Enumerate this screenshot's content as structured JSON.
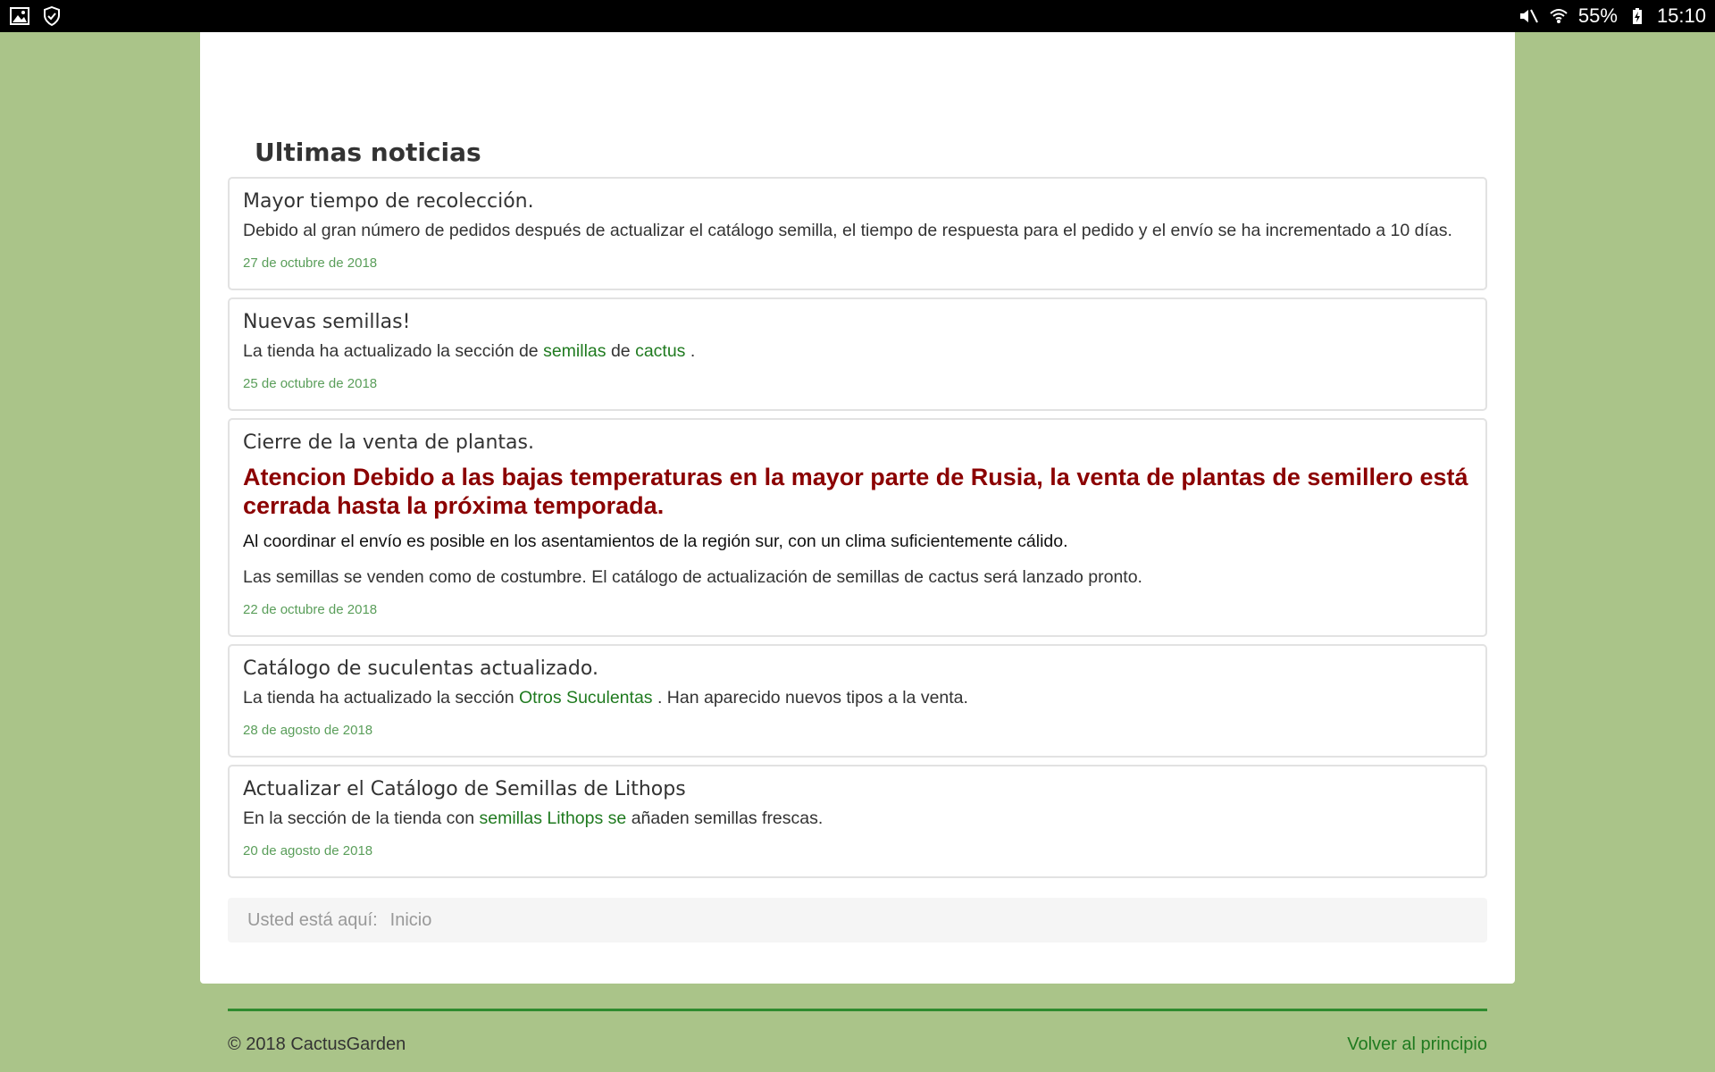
{
  "statusbar": {
    "left_icons": [
      "image-icon",
      "shield-check-icon"
    ],
    "battery": "55%",
    "time": "15:10"
  },
  "section_title": "Ultimas noticias",
  "news": [
    {
      "title": "Mayor tiempo de recolección.",
      "body": "Debido al gran número de pedidos después de actualizar el catálogo semilla, el tiempo de respuesta para el pedido y el envío se ha incrementado a 10 días.",
      "date": "27 de octubre de 2018"
    },
    {
      "title": "Nuevas semillas!",
      "body_pre": "La tienda ha actualizado la sección de",
      "link1": "semillas",
      "mid": "de",
      "link2": "cactus",
      "post": ".",
      "date": "25 de octubre de 2018"
    },
    {
      "title": "Cierre de la venta de plantas.",
      "alert": "Atencion Debido a las bajas temperaturas en la mayor parte de Rusia, la venta de plantas de semillero está cerrada hasta la próxima temporada.",
      "body1": "Al coordinar el envío es posible en los asentamientos de la región sur, con un clima suficientemente cálido.",
      "body2": "Las semillas se venden como de costumbre. El catálogo de actualización de semillas de cactus será lanzado pronto.",
      "date": "22 de octubre de 2018"
    },
    {
      "title": "Catálogo de suculentas actualizado.",
      "body_pre": "La tienda ha actualizado la sección",
      "link1": "Otros Suculentas",
      "post": ". Han aparecido nuevos tipos a la venta.",
      "date": "28 de agosto de 2018"
    },
    {
      "title": "Actualizar el Catálogo de Semillas de Lithops",
      "body_pre": "En la sección de la tienda con",
      "link1": "semillas Lithops se",
      "post": "añaden semillas frescas.",
      "date": "20 de agosto de 2018"
    }
  ],
  "breadcrumb": {
    "label": "Usted está aquí:",
    "current": "Inicio"
  },
  "footer": {
    "copyright": "© 2018 CactusGarden",
    "back_to_top": "Volver al principio"
  },
  "colors": {
    "background": "#aac489",
    "link": "#1f7a1f",
    "alert": "#8b0000",
    "date": "#5a9e5a",
    "footer_rule": "#2e8b2e"
  }
}
